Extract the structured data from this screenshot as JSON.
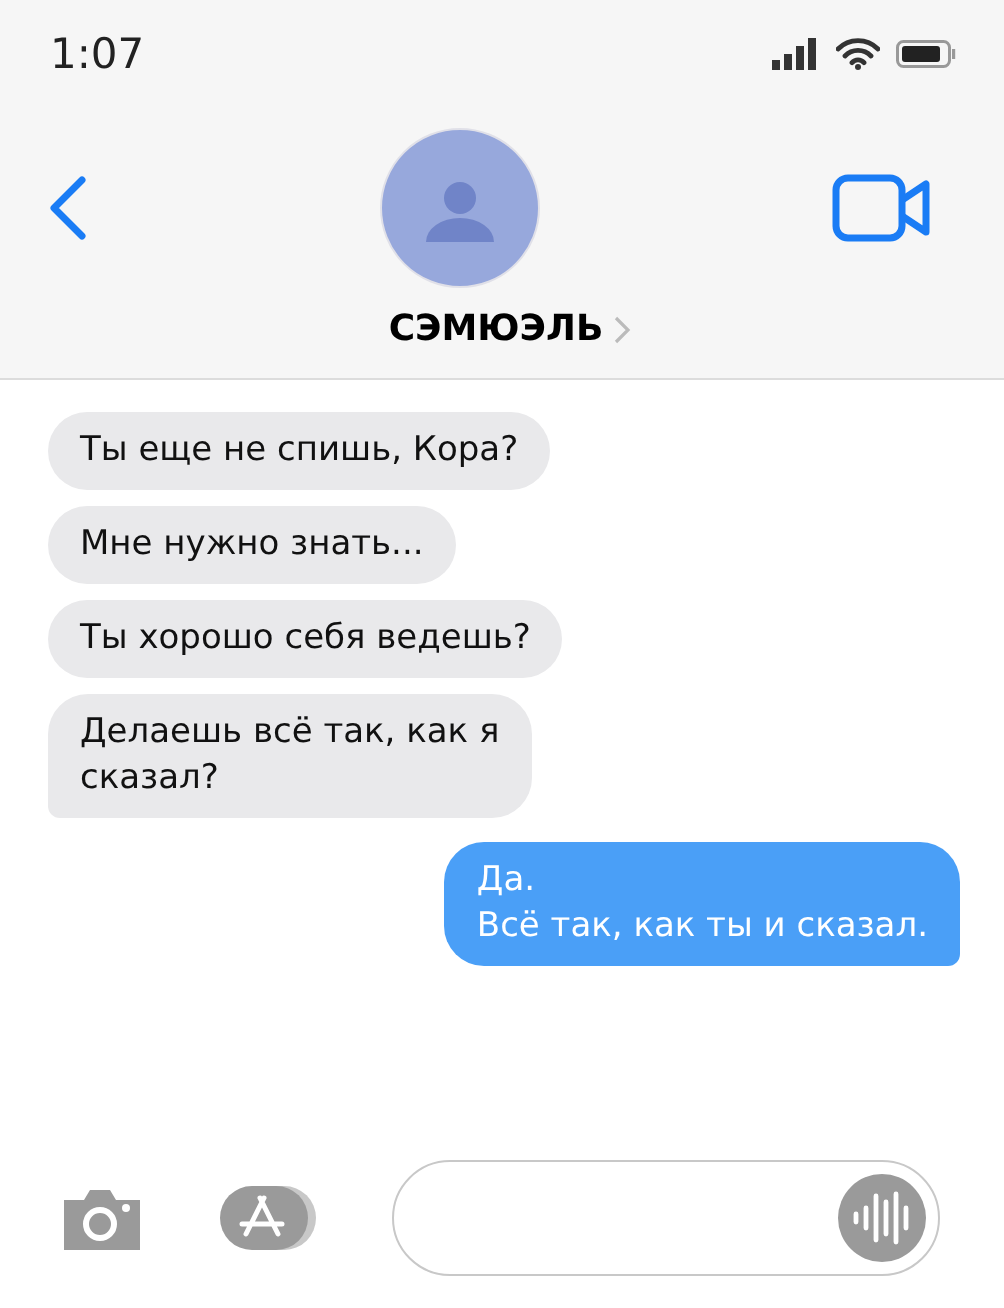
{
  "status_bar": {
    "time": "1:07"
  },
  "contact": {
    "name": "СЭМЮЭЛЬ"
  },
  "messages": [
    {
      "kind": "received",
      "text": "Ты еще не спишь, Кора?",
      "tail": false
    },
    {
      "kind": "received",
      "text": "Мне нужно знать...",
      "tail": false
    },
    {
      "kind": "received",
      "text": "Ты хорошо себя ведешь?",
      "tail": false
    },
    {
      "kind": "received",
      "text": "Делаешь всё так, как я\nсказал?",
      "tail": true
    },
    {
      "kind": "sent",
      "text": "Да.\nВсё так, как ты и сказал.",
      "tail": true
    }
  ]
}
